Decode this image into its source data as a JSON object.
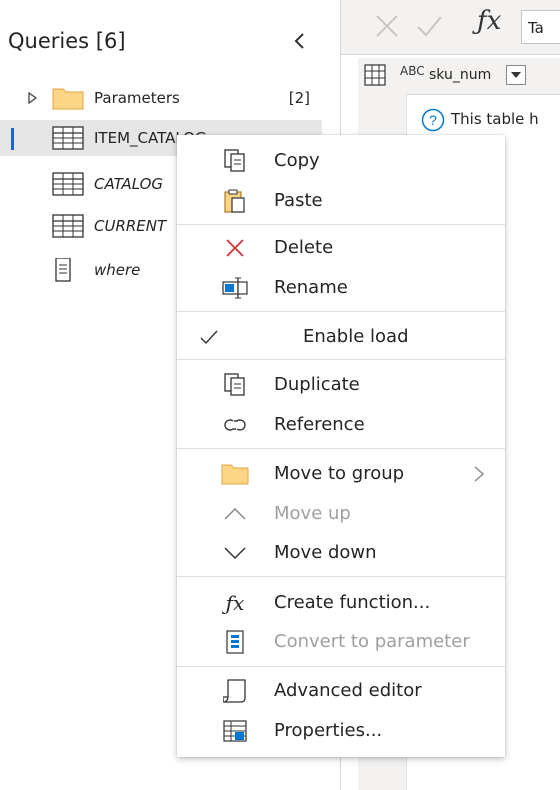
{
  "queries_pane": {
    "title": "Queries [6]",
    "items": [
      {
        "label": "Parameters",
        "count": "[2]",
        "type": "folder"
      },
      {
        "label": "ITEM_CATALOG",
        "type": "table",
        "selected": true
      },
      {
        "label": "CATALOG",
        "type": "table"
      },
      {
        "label": "CURRENT",
        "type": "table"
      },
      {
        "label": "where",
        "type": "list"
      }
    ]
  },
  "editor": {
    "formula_text": "Ta",
    "column_header": {
      "type_label": "ABC",
      "name": "sku_num"
    },
    "info_text": "This table h"
  },
  "context_menu": {
    "items": [
      {
        "label": "Copy",
        "icon": "copy-icon",
        "enabled": true
      },
      {
        "label": "Paste",
        "icon": "paste-icon",
        "enabled": true
      },
      {
        "label": "Delete",
        "icon": "delete-icon",
        "enabled": true
      },
      {
        "label": "Rename",
        "icon": "rename-icon",
        "enabled": true
      },
      {
        "label": "Enable load",
        "icon": "check-icon",
        "enabled": true,
        "checked": true,
        "highlighted": true
      },
      {
        "label": "Duplicate",
        "icon": "duplicate-icon",
        "enabled": true
      },
      {
        "label": "Reference",
        "icon": "reference-icon",
        "enabled": true
      },
      {
        "label": "Move to group",
        "icon": "folder-icon",
        "enabled": true,
        "submenu": true
      },
      {
        "label": "Move up",
        "icon": "chevron-up-icon",
        "enabled": false
      },
      {
        "label": "Move down",
        "icon": "chevron-down-icon",
        "enabled": true
      },
      {
        "label": "Create function...",
        "icon": "fx-icon",
        "enabled": true
      },
      {
        "label": "Convert to parameter",
        "icon": "parameter-icon",
        "enabled": false
      },
      {
        "label": "Advanced editor",
        "icon": "advanced-editor-icon",
        "enabled": true
      },
      {
        "label": "Properties...",
        "icon": "properties-icon",
        "enabled": true
      }
    ]
  },
  "colors": {
    "selected_row": "#e6e6e6",
    "selection_bar": "#1967d2",
    "highlight": "#ffff00",
    "delete_red": "#d13438",
    "folder_fill": "#fcd587",
    "disabled_text": "#a19f9d"
  }
}
